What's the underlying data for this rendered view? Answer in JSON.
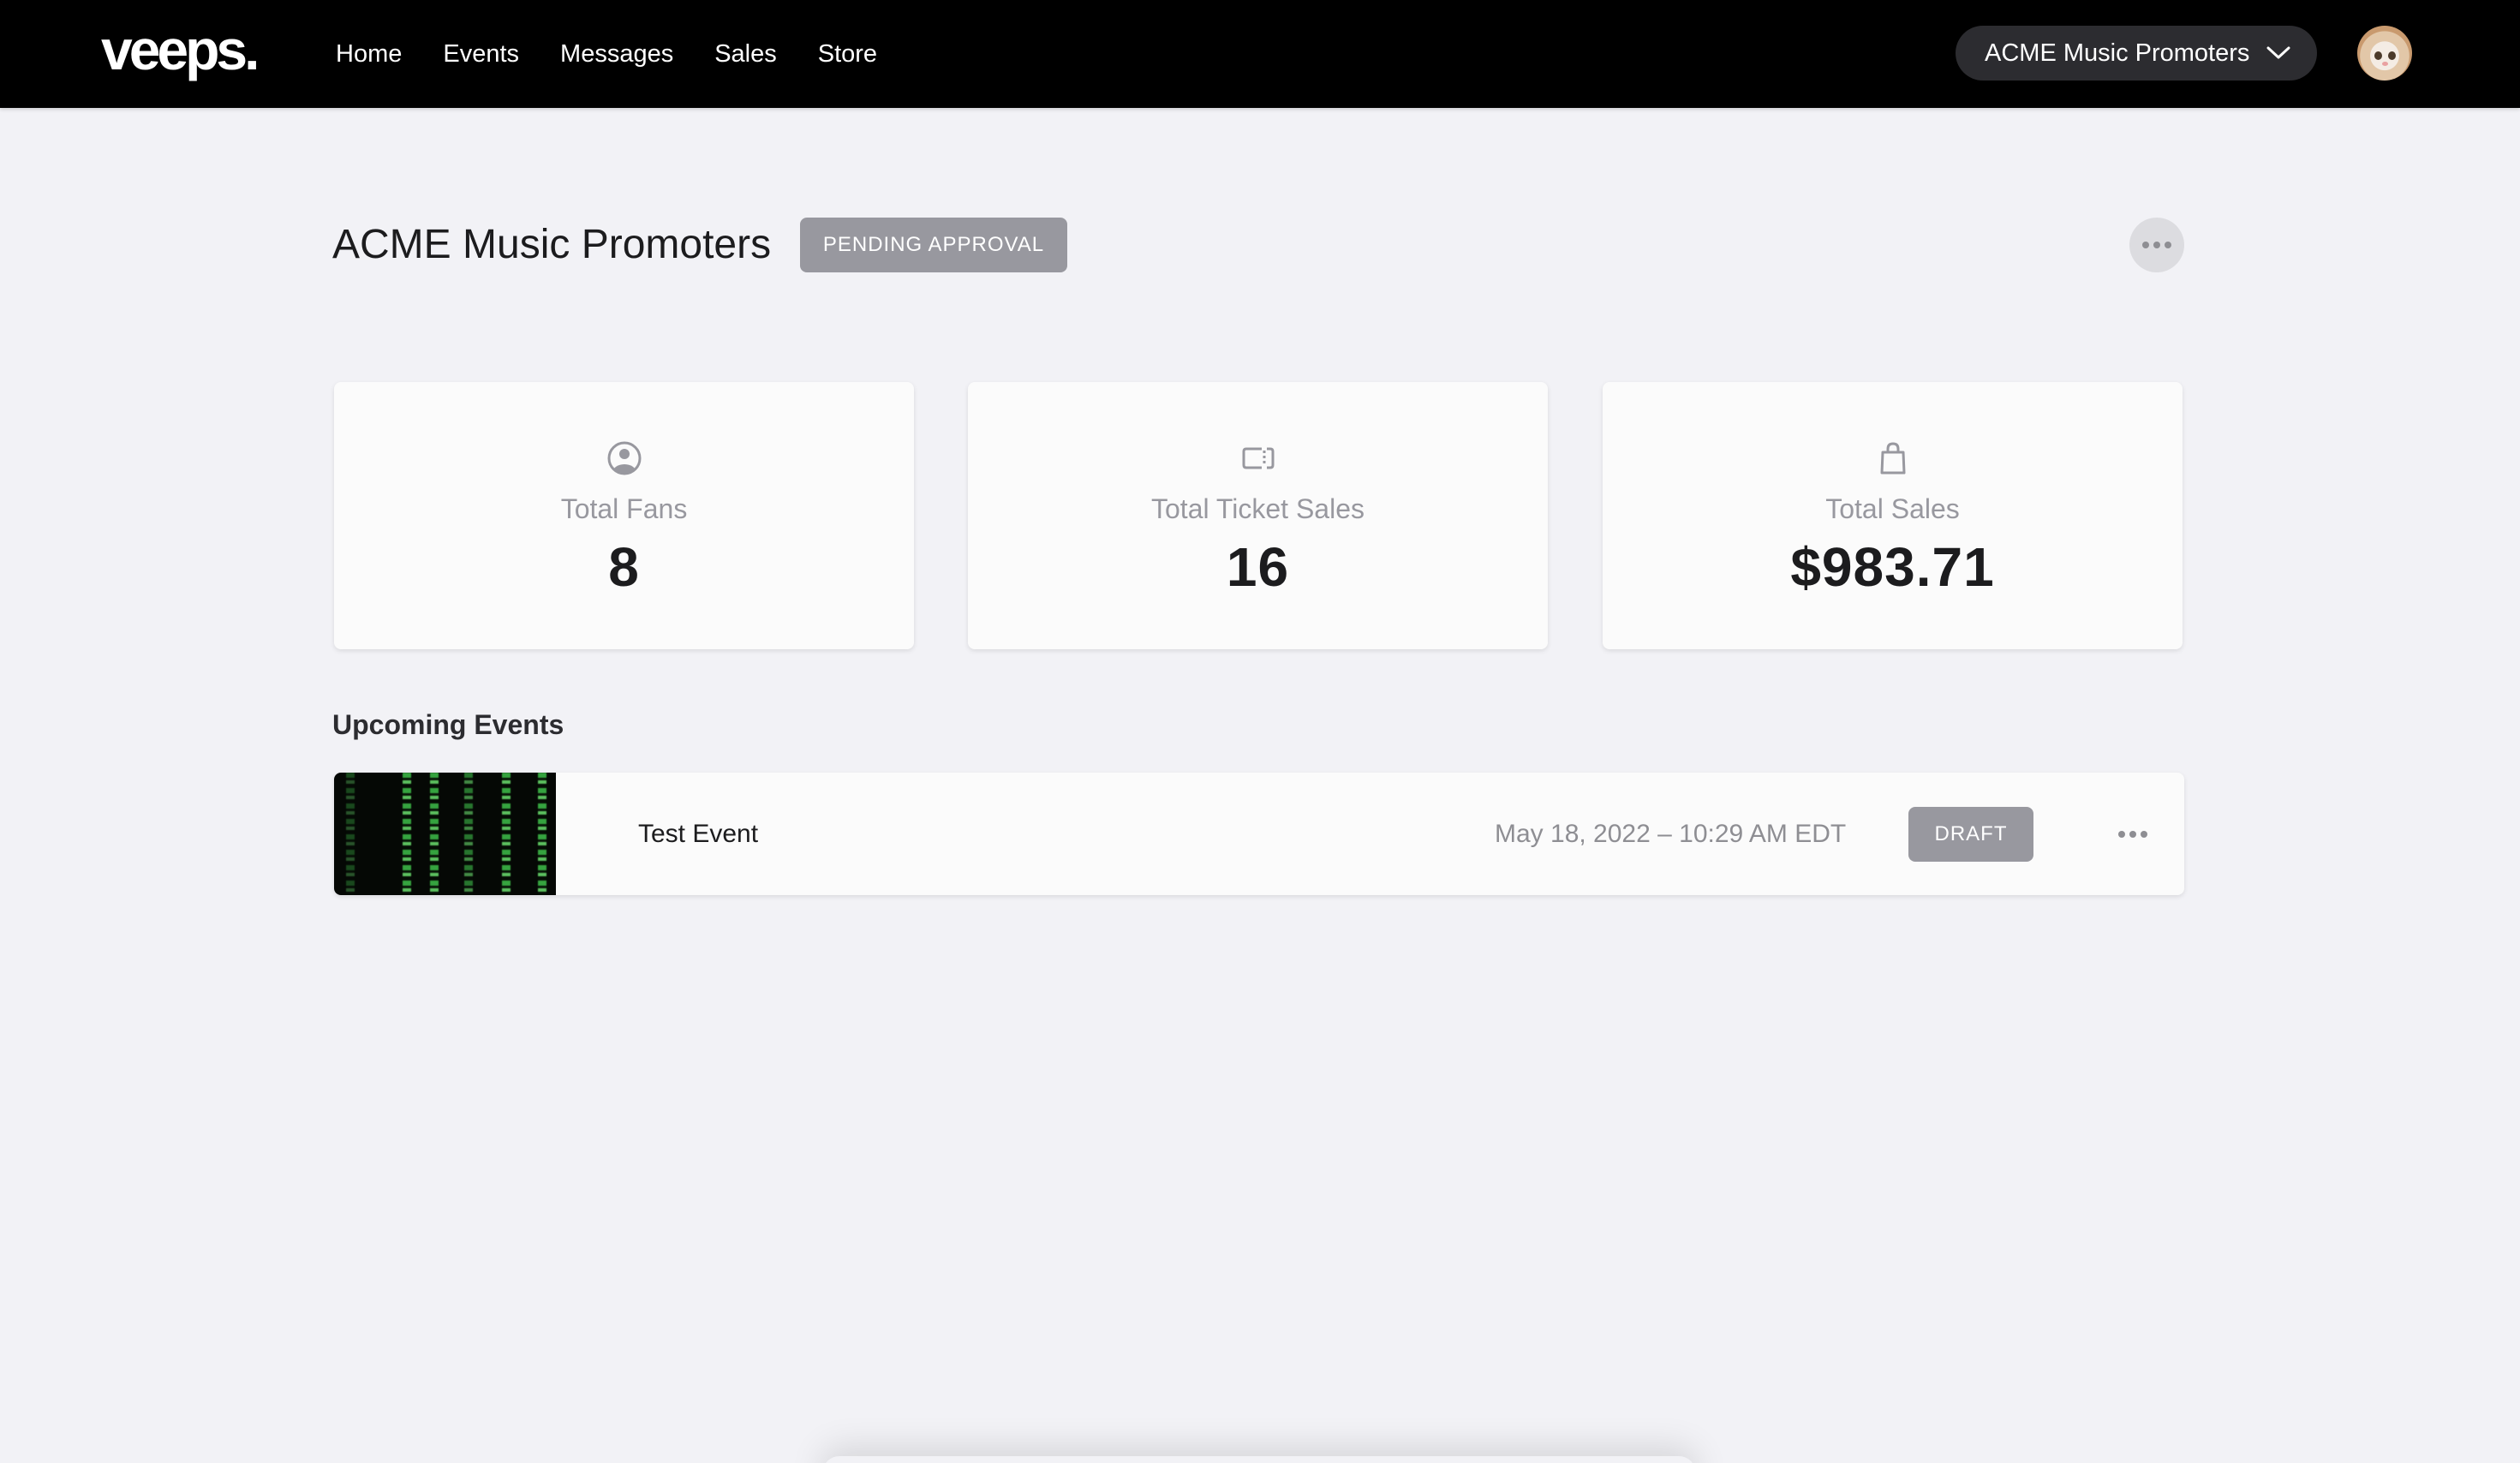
{
  "header": {
    "logo": "veeps.",
    "nav": [
      {
        "label": "Home"
      },
      {
        "label": "Events"
      },
      {
        "label": "Messages"
      },
      {
        "label": "Sales"
      },
      {
        "label": "Store"
      }
    ],
    "org_selector": {
      "label": "ACME Music Promoters",
      "icon": "chevron-down-icon"
    },
    "avatar": {
      "icon": "user-avatar-cat"
    }
  },
  "page": {
    "title": "ACME Music Promoters",
    "status_badge": "PENDING APPROVAL",
    "more_icon": "more-horizontal-icon"
  },
  "stats": [
    {
      "icon": "user-circle-icon",
      "label": "Total Fans",
      "value": "8"
    },
    {
      "icon": "ticket-icon",
      "label": "Total Ticket Sales",
      "value": "16"
    },
    {
      "icon": "shopping-bag-icon",
      "label": "Total Sales",
      "value": "$983.71"
    }
  ],
  "upcoming": {
    "heading": "Upcoming Events",
    "events": [
      {
        "title": "Test Event",
        "date": "May 18, 2022 – 10:29 AM EDT",
        "status": "DRAFT",
        "thumbnail": "green-code-rain-image"
      }
    ]
  },
  "colors": {
    "header_bg": "#000000",
    "page_bg": "#f2f2f6",
    "badge_bg": "#98989f",
    "org_pill_bg": "#2c2c30",
    "muted_text": "#98989f"
  }
}
